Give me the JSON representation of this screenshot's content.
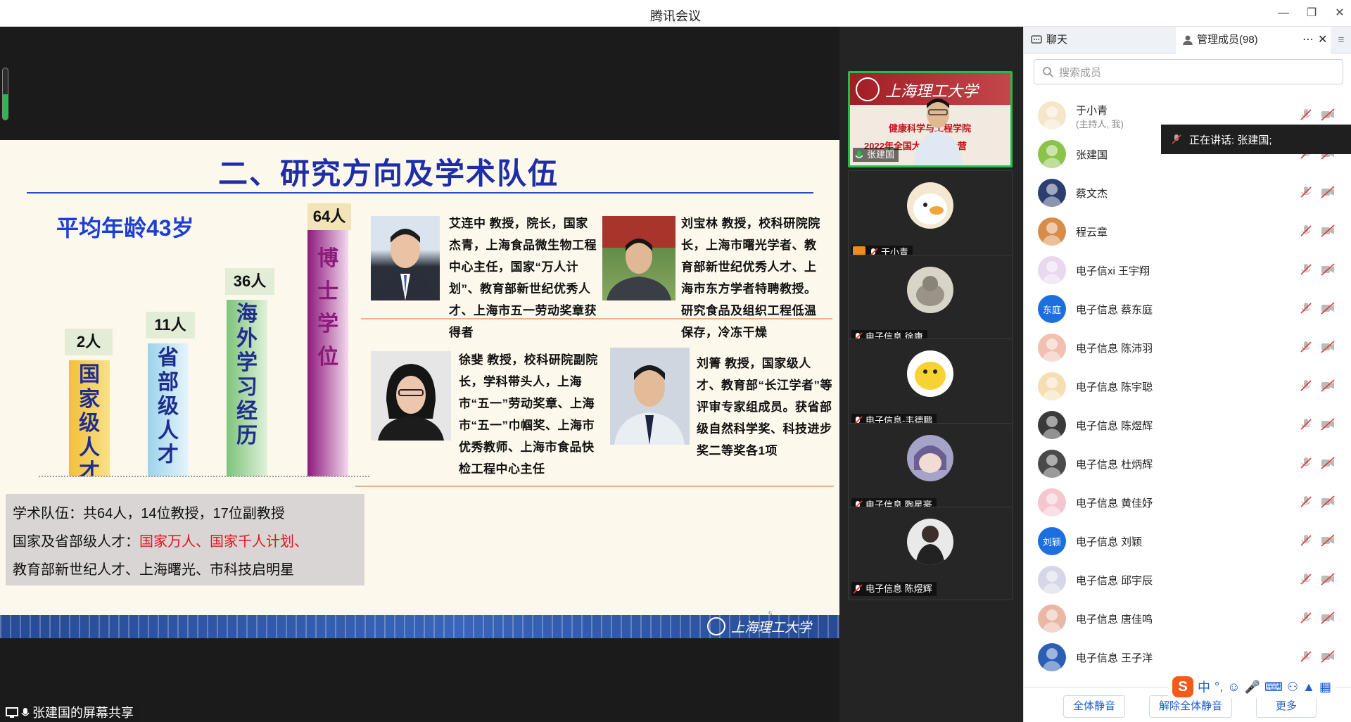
{
  "window": {
    "title": "腾讯会议"
  },
  "colors": {
    "accent": "#1d5ec9",
    "speaking_green": "#1fbf4a",
    "slide_blue": "#1e2da8",
    "highlight_red": "#e0141b"
  },
  "slide": {
    "title": "二、研究方向及学术队伍",
    "avg_age": "平均年龄43岁",
    "bars": [
      {
        "count": "2人",
        "text": "国家级人才"
      },
      {
        "count": "11人",
        "text": "省部级人才"
      },
      {
        "count": "36人",
        "text": "海外学习经历"
      },
      {
        "count": "64人",
        "text": "博士学位"
      }
    ],
    "summary": {
      "line1": "学术队伍：共64人，14位教授，17位副教授",
      "line2_prefix": "国家及省部级人才：",
      "line2_red": "国家万人、国家千人计划、",
      "line3": "教育部新世纪人才、上海曙光、市科技启明星"
    },
    "profiles": [
      "艾连中 教授，院长，国家杰青，上海食品微生物工程中心主任，国家“万人计划”、教育部新世纪优秀人才、上海市五一劳动奖章获得者",
      "刘宝林 教授，校科研院院长，上海市曙光学者、教育部新世纪优秀人才、上海市东方学者特聘教授。研究食品及组织工程低温保存，冷冻干燥",
      "徐斐 教授，校科研院副院长，学科带头人，上海市“五一”劳动奖章、上海市“五一”巾帼奖、上海市优秀教师、上海市食品快检工程中心主任",
      "刘箐 教授，国家级人才、教育部“长江学者”等评审专家组成员。获省部级自然科学奖、科技进步奖二等奖各1项"
    ],
    "footer_logo": "上海理工大学",
    "page_number": "5"
  },
  "share_status": "张建国的屏幕共享",
  "video_tiles": [
    {
      "name": "张建国",
      "banner_school": "上海理工大学",
      "banner_line2": "健康科学与工程学院",
      "banner_line3": "2022年全国大学生夏令营"
    },
    {
      "name": "于小青"
    },
    {
      "name": "电子信息 徐康"
    },
    {
      "name": "电子信息-韦德鹏"
    },
    {
      "name": "电子信息 陶星豪"
    },
    {
      "name": "电子信息 陈煜辉"
    }
  ],
  "panel": {
    "tab_chat": "聊天",
    "tab_members": "管理成员(98)",
    "search_placeholder": "搜索成员",
    "speaking": "正在讲话: 张建国;",
    "members": [
      {
        "name": "于小青",
        "sub": "(主持人, 我)",
        "avatar": "duck",
        "color": "#f4e6c8"
      },
      {
        "name": "张建国",
        "sub": "",
        "avatar": "ball",
        "color": "#8bc34a"
      },
      {
        "name": "蔡文杰",
        "sub": "",
        "avatar": "dark",
        "color": "#2c3e70"
      },
      {
        "name": "程云章",
        "sub": "",
        "avatar": "sunset",
        "color": "#d98c4a"
      },
      {
        "name": "电子信xi 王宇翔",
        "sub": "",
        "avatar": "light",
        "color": "#e8d9ef"
      },
      {
        "name": "电子信息 蔡东庭",
        "sub": "",
        "avatar": "text",
        "text": "东庭",
        "color": "#1d6fe0"
      },
      {
        "name": "电子信息 陈沛羽",
        "sub": "",
        "avatar": "face",
        "color": "#f1c0b0"
      },
      {
        "name": "电子信息 陈宇聪",
        "sub": "",
        "avatar": "cat",
        "color": "#f5deb3"
      },
      {
        "name": "电子信息 陈煜辉",
        "sub": "",
        "avatar": "dark",
        "color": "#3a3a3a"
      },
      {
        "name": "电子信息 杜炳辉",
        "sub": "",
        "avatar": "dark",
        "color": "#4a4a4a"
      },
      {
        "name": "电子信息 黄佳妤",
        "sub": "",
        "avatar": "light",
        "color": "#f3c6d0"
      },
      {
        "name": "电子信息 刘颖",
        "sub": "",
        "avatar": "text",
        "text": "刘颖",
        "color": "#1d6fe0"
      },
      {
        "name": "电子信息 邱宇辰",
        "sub": "",
        "avatar": "light",
        "color": "#d6d6e8"
      },
      {
        "name": "电子信息 唐佳鸣",
        "sub": "",
        "avatar": "face",
        "color": "#e9b7a5"
      },
      {
        "name": "电子信息 王子洋",
        "sub": "",
        "avatar": "dark",
        "color": "#2b5fb5"
      }
    ],
    "btn_mute_all": "全体静音",
    "btn_unmute_all": "解除全体静音",
    "btn_more": "更多",
    "ime_label": "中"
  }
}
